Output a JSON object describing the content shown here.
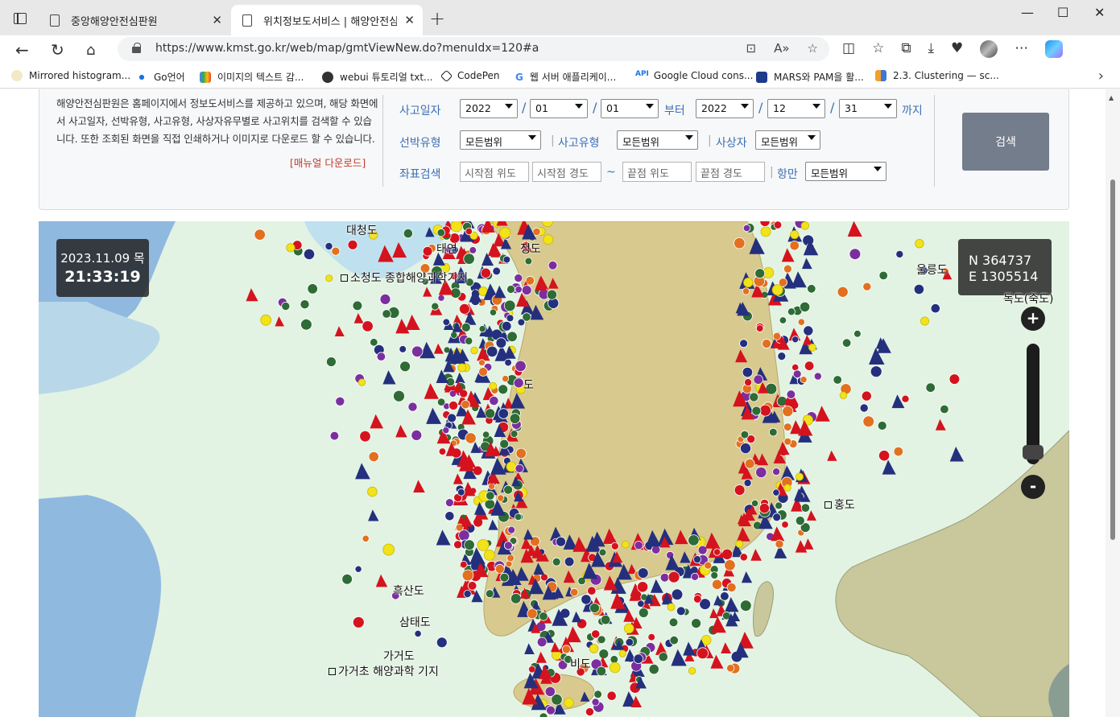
{
  "browser": {
    "tabs": [
      {
        "title": "중앙해양안전심판원",
        "active": false
      },
      {
        "title": "위치정보도서비스 | 해양안전심판원",
        "active": true
      }
    ],
    "new_tab": "+",
    "window_controls": {
      "minimize": "—",
      "maximize": "☐",
      "close": "✕"
    },
    "url": "https://www.kmst.go.kr/web/map/gmtViewNew.do?menuIdx=120#a",
    "bookmarks": [
      "Mirrored histogram...",
      "Go언어",
      "이미지의 텍스트 감...",
      "webui 튜토리얼 txt...",
      "CodePen",
      "웹 서버 애플리케이...",
      "Google Cloud cons...",
      "MARS와 PAM을 활...",
      "2.3. Clustering — sc..."
    ],
    "bookmark_more": "›"
  },
  "intro": {
    "text": "해양안전심판원은 홈페이지에서 정보도서비스를 제공하고 있으며, 해당 화면에서 사고일자, 선박유형, 사고유형, 사상자유무별로 사고위치를 검색할 수 있습니다. 또한 조회된 화면을 직접 인쇄하거나 이미지로 다운로드 할 수 있습니다.",
    "manual_link": "[매뉴얼 다운로드]"
  },
  "search": {
    "date_label": "사고일자",
    "start": {
      "year": "2022",
      "month": "01",
      "day": "01"
    },
    "from_label": "부터",
    "end": {
      "year": "2022",
      "month": "12",
      "day": "31"
    },
    "to_label": "까지",
    "separator": "/",
    "ship_type_label": "선박유형",
    "ship_type": "모든범위",
    "accident_type_label": "사고유형",
    "accident_type": "모든범위",
    "casualty_label": "사상자",
    "casualty": "모든범위",
    "coord_label": "좌표검색",
    "start_lat_placeholder": "시작점 위도",
    "start_lon_placeholder": "시작점 경도",
    "tilde": "~",
    "end_lat_placeholder": "끝점 위도",
    "end_lon_placeholder": "끝점 경도",
    "port_label": "항만",
    "port": "모든범위",
    "button": "검색"
  },
  "map": {
    "date": "2023.11.09 목",
    "time": "21:33:19",
    "coord_n": "N 364737",
    "coord_e": "E 1305514",
    "zoom_in": "+",
    "zoom_out": "-",
    "labels": [
      "대청도",
      "태연",
      "소청도 종합해양과학기지",
      "가거도",
      "가거초 해양과학 기지",
      "울릉도",
      "독도(죽도)",
      "흑산도",
      "삼태도",
      "홍도",
      "도",
      "정도",
      "비도"
    ],
    "colors": {
      "sea": "#e3f3e3",
      "land": "#d8c98e",
      "deep_water": "#8fb9df",
      "shallow": "#bfe0ee",
      "marker_green": "#2e6b35",
      "marker_yellow": "#f2e21a",
      "marker_orange": "#e2701f",
      "marker_red": "#d4131f",
      "marker_navy": "#24307d",
      "marker_purple": "#7b2f9f"
    }
  }
}
